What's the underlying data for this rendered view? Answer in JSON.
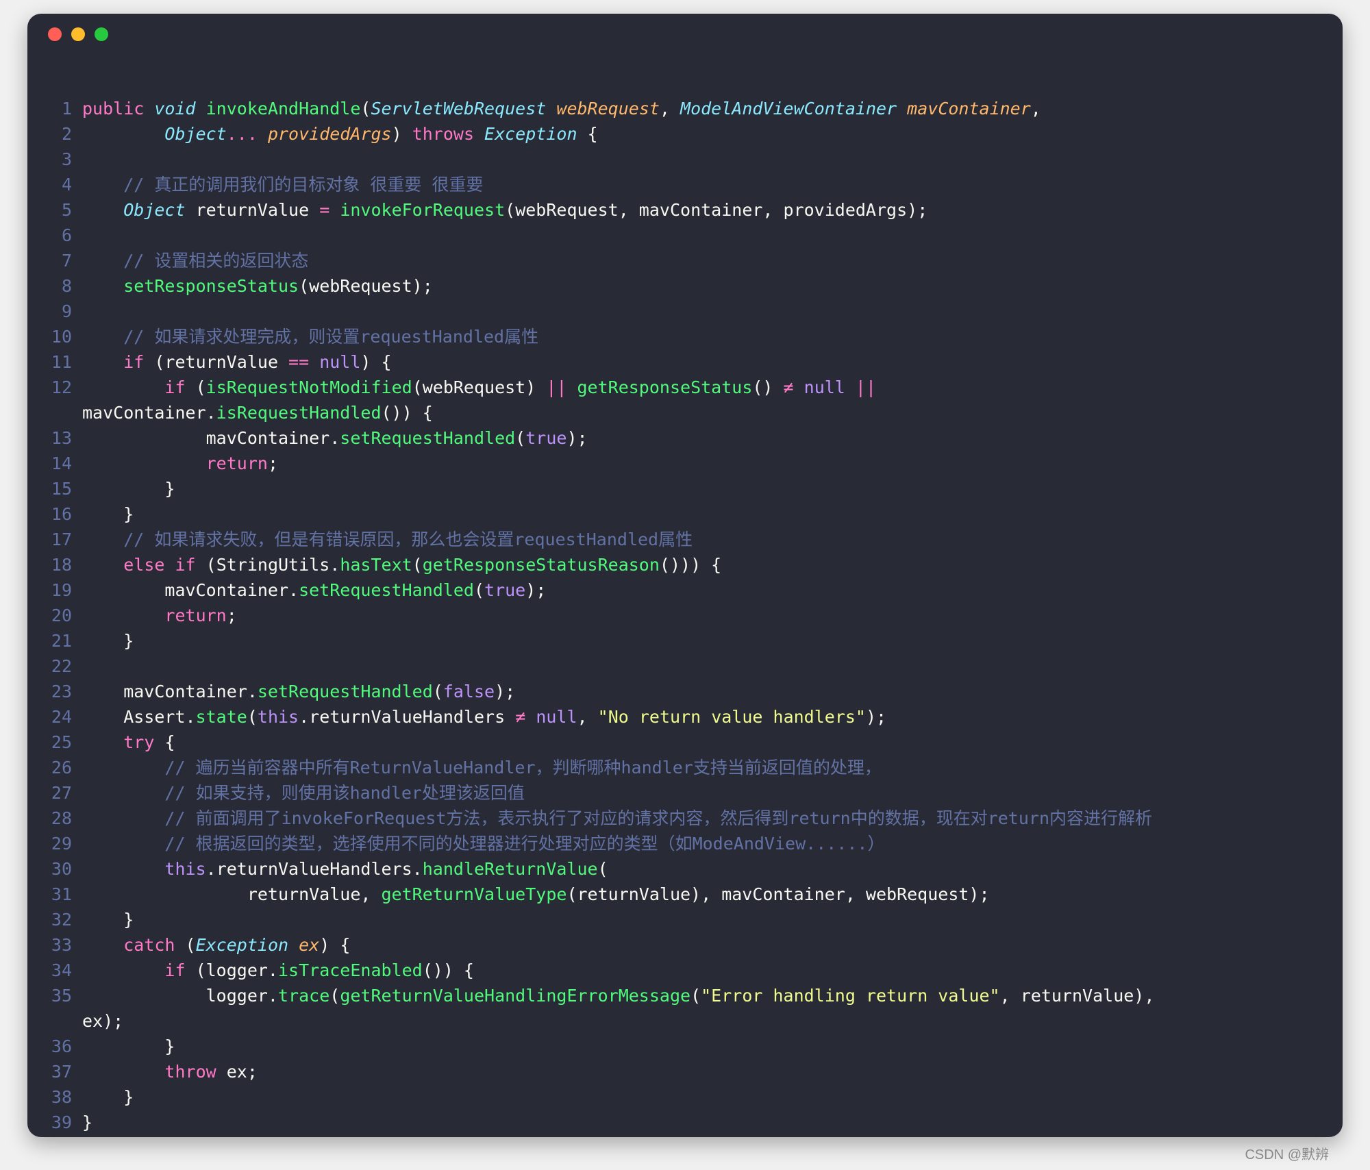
{
  "window": {
    "dot_red": "close",
    "dot_yellow": "minimize",
    "dot_green": "zoom"
  },
  "watermark": "CSDN @默辨",
  "code": {
    "lines": [
      {
        "n": 1,
        "cls": [],
        "tokens": [
          {
            "t": "public ",
            "c": "tok-keyword"
          },
          {
            "t": "void ",
            "c": "tok-type"
          },
          {
            "t": "invokeAndHandle",
            "c": "tok-ident"
          },
          {
            "t": "(",
            "c": "tok-punc"
          },
          {
            "t": "ServletWebRequest ",
            "c": "tok-type"
          },
          {
            "t": "webRequest",
            "c": "tok-param"
          },
          {
            "t": ", ",
            "c": "tok-punc"
          },
          {
            "t": "ModelAndViewContainer ",
            "c": "tok-type"
          },
          {
            "t": "mavContainer",
            "c": "tok-param"
          },
          {
            "t": ",",
            "c": "tok-punc"
          }
        ]
      },
      {
        "n": 2,
        "tokens": [
          {
            "t": "        ",
            "c": ""
          },
          {
            "t": "Object",
            "c": "tok-type"
          },
          {
            "t": "... ",
            "c": "tok-keyword"
          },
          {
            "t": "providedArgs",
            "c": "tok-param"
          },
          {
            "t": ") ",
            "c": "tok-punc"
          },
          {
            "t": "throws ",
            "c": "tok-keyword"
          },
          {
            "t": "Exception ",
            "c": "tok-type"
          },
          {
            "t": "{",
            "c": "tok-punc"
          }
        ]
      },
      {
        "n": 3,
        "tokens": [
          {
            "t": "",
            "c": ""
          }
        ]
      },
      {
        "n": 4,
        "tokens": [
          {
            "t": "    ",
            "c": ""
          },
          {
            "t": "// 真正的调用我们的目标对象 很重要 很重要",
            "c": "tok-comment"
          }
        ]
      },
      {
        "n": 5,
        "tokens": [
          {
            "t": "    ",
            "c": ""
          },
          {
            "t": "Object ",
            "c": "tok-type"
          },
          {
            "t": "returnValue ",
            "c": "tok-var"
          },
          {
            "t": "= ",
            "c": "tok-op"
          },
          {
            "t": "invokeForRequest",
            "c": "tok-ident"
          },
          {
            "t": "(webRequest, mavContainer, providedArgs);",
            "c": "tok-punc"
          }
        ]
      },
      {
        "n": 6,
        "tokens": [
          {
            "t": "",
            "c": ""
          }
        ]
      },
      {
        "n": 7,
        "tokens": [
          {
            "t": "    ",
            "c": ""
          },
          {
            "t": "// 设置相关的返回状态",
            "c": "tok-comment"
          }
        ]
      },
      {
        "n": 8,
        "tokens": [
          {
            "t": "    ",
            "c": ""
          },
          {
            "t": "setResponseStatus",
            "c": "tok-ident"
          },
          {
            "t": "(webRequest);",
            "c": "tok-punc"
          }
        ]
      },
      {
        "n": 9,
        "tokens": [
          {
            "t": "",
            "c": ""
          }
        ]
      },
      {
        "n": 10,
        "tokens": [
          {
            "t": "    ",
            "c": ""
          },
          {
            "t": "// 如果请求处理完成，则设置requestHandled属性",
            "c": "tok-comment"
          }
        ]
      },
      {
        "n": 11,
        "tokens": [
          {
            "t": "    ",
            "c": ""
          },
          {
            "t": "if ",
            "c": "tok-keyword"
          },
          {
            "t": "(returnValue ",
            "c": "tok-punc"
          },
          {
            "t": "== ",
            "c": "tok-op"
          },
          {
            "t": "null",
            "c": "tok-bool"
          },
          {
            "t": ") {",
            "c": "tok-punc"
          }
        ]
      },
      {
        "n": 12,
        "tokens": [
          {
            "t": "        ",
            "c": ""
          },
          {
            "t": "if ",
            "c": "tok-keyword"
          },
          {
            "t": "(",
            "c": "tok-punc"
          },
          {
            "t": "isRequestNotModified",
            "c": "tok-ident"
          },
          {
            "t": "(webRequest) ",
            "c": "tok-punc"
          },
          {
            "t": "|| ",
            "c": "tok-op"
          },
          {
            "t": "getResponseStatus",
            "c": "tok-ident"
          },
          {
            "t": "() ",
            "c": "tok-punc"
          },
          {
            "t": "≠ ",
            "c": "tok-op"
          },
          {
            "t": "null ",
            "c": "tok-bool"
          },
          {
            "t": "|| ",
            "c": "tok-op"
          }
        ]
      },
      {
        "n": "",
        "tokens": [
          {
            "t": "mavContainer.",
            "c": "tok-punc"
          },
          {
            "t": "isRequestHandled",
            "c": "tok-ident"
          },
          {
            "t": "()) {",
            "c": "tok-punc"
          }
        ]
      },
      {
        "n": 13,
        "tokens": [
          {
            "t": "            mavContainer.",
            "c": "tok-punc"
          },
          {
            "t": "setRequestHandled",
            "c": "tok-ident"
          },
          {
            "t": "(",
            "c": "tok-punc"
          },
          {
            "t": "true",
            "c": "tok-bool"
          },
          {
            "t": ");",
            "c": "tok-punc"
          }
        ]
      },
      {
        "n": 14,
        "tokens": [
          {
            "t": "            ",
            "c": ""
          },
          {
            "t": "return",
            "c": "tok-keyword"
          },
          {
            "t": ";",
            "c": "tok-punc"
          }
        ]
      },
      {
        "n": 15,
        "tokens": [
          {
            "t": "        }",
            "c": "tok-punc"
          }
        ]
      },
      {
        "n": 16,
        "tokens": [
          {
            "t": "    }",
            "c": "tok-punc"
          }
        ]
      },
      {
        "n": 17,
        "tokens": [
          {
            "t": "    ",
            "c": ""
          },
          {
            "t": "// 如果请求失败，但是有错误原因，那么也会设置requestHandled属性",
            "c": "tok-comment"
          }
        ]
      },
      {
        "n": 18,
        "tokens": [
          {
            "t": "    ",
            "c": ""
          },
          {
            "t": "else if ",
            "c": "tok-keyword"
          },
          {
            "t": "(StringUtils.",
            "c": "tok-punc"
          },
          {
            "t": "hasText",
            "c": "tok-ident"
          },
          {
            "t": "(",
            "c": "tok-punc"
          },
          {
            "t": "getResponseStatusReason",
            "c": "tok-ident"
          },
          {
            "t": "())) {",
            "c": "tok-punc"
          }
        ]
      },
      {
        "n": 19,
        "tokens": [
          {
            "t": "        mavContainer.",
            "c": "tok-punc"
          },
          {
            "t": "setRequestHandled",
            "c": "tok-ident"
          },
          {
            "t": "(",
            "c": "tok-punc"
          },
          {
            "t": "true",
            "c": "tok-bool"
          },
          {
            "t": ");",
            "c": "tok-punc"
          }
        ]
      },
      {
        "n": 20,
        "tokens": [
          {
            "t": "        ",
            "c": ""
          },
          {
            "t": "return",
            "c": "tok-keyword"
          },
          {
            "t": ";",
            "c": "tok-punc"
          }
        ]
      },
      {
        "n": 21,
        "tokens": [
          {
            "t": "    }",
            "c": "tok-punc"
          }
        ]
      },
      {
        "n": 22,
        "tokens": [
          {
            "t": "",
            "c": ""
          }
        ]
      },
      {
        "n": 23,
        "tokens": [
          {
            "t": "    mavContainer.",
            "c": "tok-punc"
          },
          {
            "t": "setRequestHandled",
            "c": "tok-ident"
          },
          {
            "t": "(",
            "c": "tok-punc"
          },
          {
            "t": "false",
            "c": "tok-bool"
          },
          {
            "t": ");",
            "c": "tok-punc"
          }
        ]
      },
      {
        "n": 24,
        "tokens": [
          {
            "t": "    Assert.",
            "c": "tok-punc"
          },
          {
            "t": "state",
            "c": "tok-ident"
          },
          {
            "t": "(",
            "c": "tok-punc"
          },
          {
            "t": "this",
            "c": "tok-bool"
          },
          {
            "t": ".returnValueHandlers ",
            "c": "tok-punc"
          },
          {
            "t": "≠ ",
            "c": "tok-op"
          },
          {
            "t": "null",
            "c": "tok-bool"
          },
          {
            "t": ", ",
            "c": "tok-punc"
          },
          {
            "t": "\"No return value handlers\"",
            "c": "tok-string"
          },
          {
            "t": ");",
            "c": "tok-punc"
          }
        ]
      },
      {
        "n": 25,
        "tokens": [
          {
            "t": "    ",
            "c": ""
          },
          {
            "t": "try ",
            "c": "tok-keyword"
          },
          {
            "t": "{",
            "c": "tok-punc"
          }
        ]
      },
      {
        "n": 26,
        "tokens": [
          {
            "t": "        ",
            "c": ""
          },
          {
            "t": "// 遍历当前容器中所有ReturnValueHandler，判断哪种handler支持当前返回值的处理，",
            "c": "tok-comment"
          }
        ]
      },
      {
        "n": 27,
        "tokens": [
          {
            "t": "        ",
            "c": ""
          },
          {
            "t": "// 如果支持，则使用该handler处理该返回值",
            "c": "tok-comment"
          }
        ]
      },
      {
        "n": 28,
        "tokens": [
          {
            "t": "        ",
            "c": ""
          },
          {
            "t": "// 前面调用了invokeForRequest方法，表示执行了对应的请求内容，然后得到return中的数据，现在对return内容进行解析",
            "c": "tok-comment"
          }
        ]
      },
      {
        "n": 29,
        "tokens": [
          {
            "t": "        ",
            "c": ""
          },
          {
            "t": "// 根据返回的类型，选择使用不同的处理器进行处理对应的类型（如ModeAndView......）",
            "c": "tok-comment"
          }
        ]
      },
      {
        "n": 30,
        "tokens": [
          {
            "t": "        ",
            "c": ""
          },
          {
            "t": "this",
            "c": "tok-bool"
          },
          {
            "t": ".returnValueHandlers.",
            "c": "tok-punc"
          },
          {
            "t": "handleReturnValue",
            "c": "tok-ident"
          },
          {
            "t": "(",
            "c": "tok-punc"
          }
        ]
      },
      {
        "n": 31,
        "tokens": [
          {
            "t": "                returnValue, ",
            "c": "tok-punc"
          },
          {
            "t": "getReturnValueType",
            "c": "tok-ident"
          },
          {
            "t": "(returnValue), mavContainer, webRequest);",
            "c": "tok-punc"
          }
        ]
      },
      {
        "n": 32,
        "tokens": [
          {
            "t": "    }",
            "c": "tok-punc"
          }
        ]
      },
      {
        "n": 33,
        "tokens": [
          {
            "t": "    ",
            "c": ""
          },
          {
            "t": "catch ",
            "c": "tok-keyword"
          },
          {
            "t": "(",
            "c": "tok-punc"
          },
          {
            "t": "Exception ",
            "c": "tok-type"
          },
          {
            "t": "ex",
            "c": "tok-param"
          },
          {
            "t": ") {",
            "c": "tok-punc"
          }
        ]
      },
      {
        "n": 34,
        "tokens": [
          {
            "t": "        ",
            "c": ""
          },
          {
            "t": "if ",
            "c": "tok-keyword"
          },
          {
            "t": "(logger.",
            "c": "tok-punc"
          },
          {
            "t": "isTraceEnabled",
            "c": "tok-ident"
          },
          {
            "t": "()) {",
            "c": "tok-punc"
          }
        ]
      },
      {
        "n": 35,
        "tokens": [
          {
            "t": "            logger.",
            "c": "tok-punc"
          },
          {
            "t": "trace",
            "c": "tok-ident"
          },
          {
            "t": "(",
            "c": "tok-punc"
          },
          {
            "t": "getReturnValueHandlingErrorMessage",
            "c": "tok-ident"
          },
          {
            "t": "(",
            "c": "tok-punc"
          },
          {
            "t": "\"Error handling return value\"",
            "c": "tok-string"
          },
          {
            "t": ", returnValue), ",
            "c": "tok-punc"
          }
        ]
      },
      {
        "n": "",
        "tokens": [
          {
            "t": "ex);",
            "c": "tok-punc"
          }
        ]
      },
      {
        "n": 36,
        "tokens": [
          {
            "t": "        }",
            "c": "tok-punc"
          }
        ]
      },
      {
        "n": 37,
        "tokens": [
          {
            "t": "        ",
            "c": ""
          },
          {
            "t": "throw ",
            "c": "tok-keyword"
          },
          {
            "t": "ex;",
            "c": "tok-punc"
          }
        ]
      },
      {
        "n": 38,
        "tokens": [
          {
            "t": "    }",
            "c": "tok-punc"
          }
        ]
      },
      {
        "n": 39,
        "tokens": [
          {
            "t": "}",
            "c": "tok-punc"
          }
        ]
      }
    ]
  }
}
